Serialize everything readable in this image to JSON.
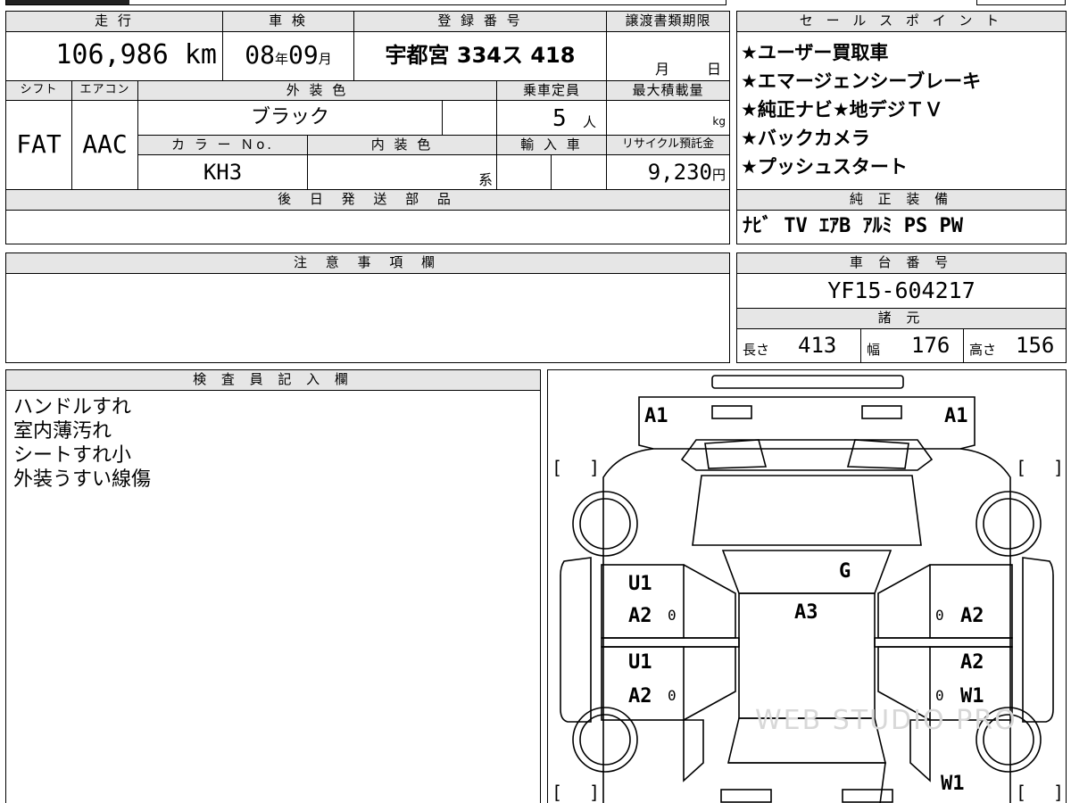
{
  "header": {
    "mileage_label": "走 行",
    "inspection_label": "車 検",
    "registration_label": "登 録 番 号",
    "transfer_deadline_label": "譲渡書類期限",
    "sales_points_label": "セ ー ル ス ポ イ ン ト"
  },
  "vehicle": {
    "mileage_value": "106,986",
    "mileage_unit": "km",
    "inspection_year": "08",
    "inspection_year_unit": "年",
    "inspection_month": "09",
    "inspection_month_unit": "月",
    "registration_number": "宇都宮 334ス 418",
    "transfer_month_unit": "月",
    "transfer_day_unit": "日",
    "shift_label": "シフト",
    "aircon_label": "エアコン",
    "exterior_color_label": "外 装 色",
    "capacity_label": "乗車定員",
    "max_load_label": "最大積載量",
    "shift_value": "FAT",
    "aircon_value": "AAC",
    "exterior_color_value": "ブラック",
    "capacity_value": "5",
    "capacity_unit": "人",
    "max_load_unit": "kg",
    "color_no_label": "カ ラ ー Ｎo.",
    "interior_color_label": "内 装 色",
    "import_label": "輸 入 車",
    "recycle_label": "リサイクル預託金",
    "color_no_value": "KH3",
    "interior_color_unit": "系",
    "recycle_value": "9,230",
    "recycle_unit": "円",
    "later_parts_label": "後 日 発 送 部 品"
  },
  "sales_points": [
    "★ユーザー買取車",
    "★エマージェンシーブレーキ",
    "★純正ナビ★地デジＴＶ",
    "★バックカメラ",
    "★プッシュスタート"
  ],
  "equipment": {
    "label": "純 正 装 備",
    "value": "ﾅﾋﾞ TV ｴｱB ｱﾙﾐ PS PW"
  },
  "caution": {
    "label": "注 意 事 項 欄"
  },
  "chassis": {
    "label": "車 台 番 号",
    "value": "YF15-604217",
    "specs_label": "諸 元",
    "length_label": "長さ",
    "length_value": "413",
    "width_label": "幅",
    "width_value": "176",
    "height_label": "高さ",
    "height_value": "156"
  },
  "inspector": {
    "label": "検 査 員 記 入 欄",
    "notes": [
      "ハンドルすれ",
      "室内薄汚れ",
      "シートすれ小",
      "外装うすい線傷"
    ]
  },
  "diagram": {
    "codes": {
      "front_left": "A1",
      "front_right": "A1",
      "glass": "G",
      "roof": "A3",
      "left_front_door_1": "U1",
      "left_front_door_2": "A2",
      "left_rear_door_1": "U1",
      "left_rear_door_2": "A2",
      "right_front_door": "A2",
      "right_rear_door_1": "A2",
      "right_rear_door_2": "W1",
      "rear_right": "W1"
    },
    "zero": "0",
    "bracket_open": "[",
    "bracket_close": "]",
    "watermark": "WEB STUDIO PRO"
  }
}
